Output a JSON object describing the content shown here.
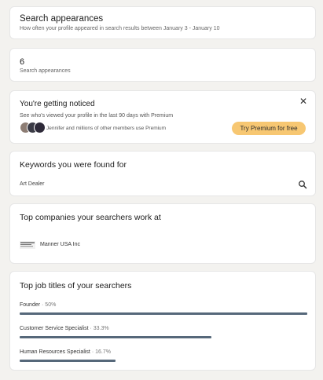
{
  "search_card": {
    "title": "Search appearances",
    "subtitle": "How often your profile appeared in search results between January 3 - January 10"
  },
  "count_card": {
    "count": "6",
    "label": "Search appearances"
  },
  "notice_card": {
    "title": "You're getting noticed",
    "description": "See who's viewed your profile in the last 90 days with Premium",
    "members_text": "Jennifer and millions of other members use Premium",
    "cta_label": "Try Premium for free",
    "close_icon": "close-icon",
    "cta_color": "#f7c772"
  },
  "keywords_card": {
    "title": "Keywords you were found for",
    "keyword": "Art Dealer",
    "icon": "search-icon"
  },
  "companies_card": {
    "title": "Top companies your searchers work at",
    "company": "Manner USA Inc"
  },
  "titles_card": {
    "title": "Top job titles of your searchers",
    "bar_color": "#56687a",
    "rows": [
      {
        "label": "Founder",
        "pct": "· 50%",
        "fraction": 1.0
      },
      {
        "label": "Customer Service Specialist",
        "pct": "· 33.3%",
        "fraction": 0.666
      },
      {
        "label": "Human Resources Specialist",
        "pct": "· 16.7%",
        "fraction": 0.334
      }
    ]
  }
}
